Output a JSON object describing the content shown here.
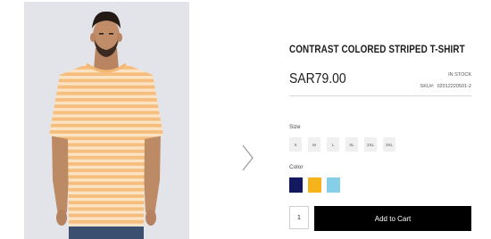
{
  "product": {
    "title": "CONTRAST COLORED STRIPED T-SHIRT",
    "price": "SAR79.00",
    "stock_status": "IN STOCK",
    "sku_label": "SKU#:",
    "sku_value": "02012220501-2"
  },
  "size": {
    "label": "Size",
    "options": [
      "S",
      "M",
      "L",
      "XL",
      "2XL",
      "3XL"
    ]
  },
  "color": {
    "label": "Color",
    "options": [
      {
        "name": "navy",
        "hex": "#13195e"
      },
      {
        "name": "yellow",
        "hex": "#f5b41c"
      },
      {
        "name": "light-blue",
        "hex": "#86cfe9"
      }
    ]
  },
  "cart": {
    "quantity": "1",
    "add_label": "Add to Cart"
  },
  "gallery": {
    "next_icon": "chevron-right-icon",
    "shirt_colors": [
      "#f7c285",
      "#fbe6c8"
    ]
  }
}
